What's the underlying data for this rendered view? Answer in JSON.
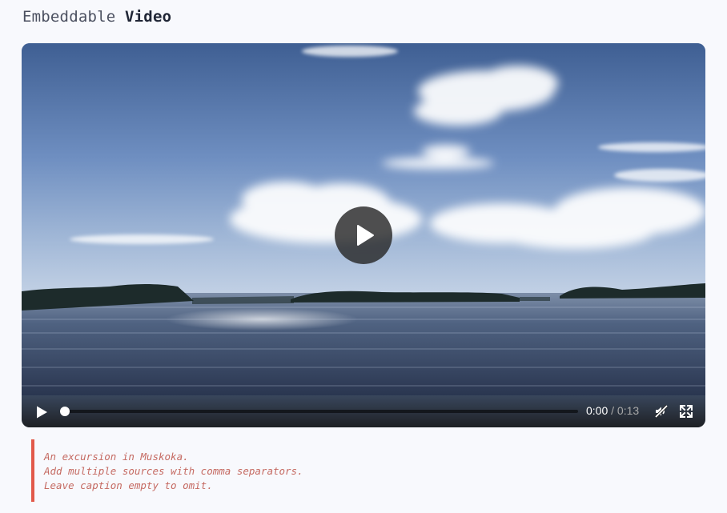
{
  "header": {
    "title_prefix": "Embeddable",
    "title_emphasis": "Video"
  },
  "player": {
    "big_play_icon": "play-icon",
    "controls": {
      "play_icon": "play-icon",
      "current_time": "0:00",
      "separator": "/",
      "duration": "0:13",
      "progress": 0.0,
      "mute_icon": "muted-speaker-icon",
      "fullscreen_icon": "fullscreen-icon"
    }
  },
  "caption": {
    "lines": [
      "An excursion in Muskoka.",
      "Add multiple sources with comma separators.",
      "Leave caption empty to omit."
    ],
    "accent_color": "#e2594a"
  }
}
